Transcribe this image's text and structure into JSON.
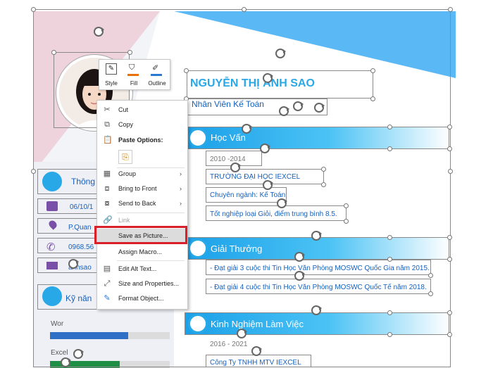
{
  "cv": {
    "name": "NGUYỄN THỊ ÁNH SAO",
    "job_title": "Nhân Viên Kế Toán",
    "contact_section": "Thông",
    "birthday": "06/10/1",
    "address": "P.Quan",
    "phone": "0968.56",
    "email": "anhsao",
    "skills_section": "Kỹ năn",
    "skills": [
      {
        "label": "Wor",
        "level": 0.65,
        "color": "#2f6fc5"
      },
      {
        "label": "Excel",
        "level": 0.58,
        "color": "#1f8f45"
      }
    ],
    "education": {
      "title": "Học Vấn",
      "period": "2010 -2014",
      "school": "TRƯỜNG ĐẠI HỌC IEXCEL",
      "major": "Chuyên ngành: Kế Toán.",
      "result": "Tốt nghiệp loại Giỏi, điểm trung bình 8.5."
    },
    "awards": {
      "title": "Giải Thưởng",
      "items": [
        "- Đạt giải 3 cuộc thi Tin Học Văn Phòng MOSWC Quốc Gia năm 2015.",
        "- Đạt giải 4 cuộc thi Tin Học Văn Phòng MOSWC Quốc Tế năm 2018."
      ]
    },
    "experience": {
      "title": "Kinh Nghiệm Làm Việc",
      "period": "2016 - 2021",
      "company": "Công Ty TNHH MTV IEXCEL"
    }
  },
  "mini_toolbar": {
    "style_label": "Style",
    "fill_label": "Fill",
    "outline_label": "Outline"
  },
  "context_menu": {
    "cut": "Cut",
    "copy": "Copy",
    "paste_options": "Paste Options:",
    "group": "Group",
    "bring_to_front": "Bring to Front",
    "send_to_back": "Send to Back",
    "link": "Link",
    "save_as_picture": "Save as Picture...",
    "assign_macro": "Assign Macro...",
    "edit_alt_text": "Edit Alt Text...",
    "size_and_properties": "Size and Properties...",
    "format_object": "Format Object..."
  },
  "colors": {
    "accent_blue": "#29a8e8",
    "pink_shape": "#f6b6c4",
    "text_blue": "#1560bd",
    "highlight_red": "#d8202a"
  }
}
